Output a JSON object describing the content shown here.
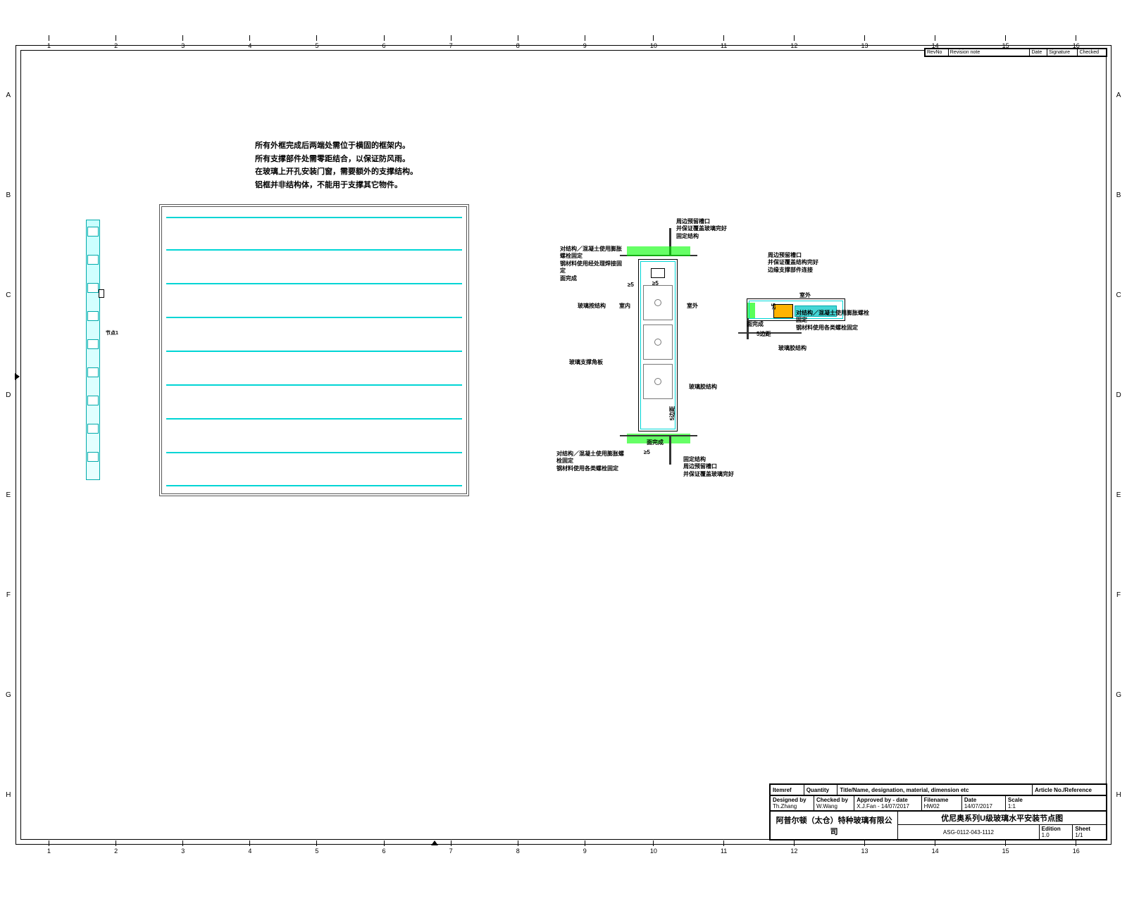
{
  "ruler": {
    "cols": [
      "1",
      "2",
      "3",
      "4",
      "5",
      "6",
      "7",
      "8",
      "9",
      "10",
      "11",
      "12",
      "13",
      "14",
      "15",
      "16"
    ],
    "rows": [
      "A",
      "B",
      "C",
      "D",
      "E",
      "F",
      "G",
      "H"
    ]
  },
  "notes": {
    "l1": "所有外框完成后两端处需位于横固的框架内。",
    "l2": "所有支撑部件处需零距结合，以保证防风雨。",
    "l3": "在玻璃上开孔安装门窗，需要额外的支撑结构。",
    "l4": "铝框并非结构体，不能用于支撑其它物件。"
  },
  "strip_label": "节点1",
  "vdet": {
    "label_top1": "对结构／混凝土使用膨胀螺栓固定",
    "label_top2": "钢材料使用经处理焊接固定",
    "label_top3": "面完成",
    "label_right1": "周边预留槽口",
    "label_right2": "并保证覆盖玻璃完好",
    "label_right3": "固定结构",
    "label_in": "室内",
    "label_out": "室外",
    "seal_l": "玻璃按结构",
    "frame_l": "玻璃支撑角板",
    "seal_r": "玻璃胶结构",
    "bot_l1": "对结构／混凝土使用膨胀螺栓固定",
    "bot_l2": "钢材料使用各类螺栓固定",
    "bot_r1": "固定结构",
    "bot_r2": "周边预留槽口",
    "bot_r3": "并保证覆盖玻璃完好",
    "bot_face": "面完成",
    "d_top": "≥5",
    "d_sq": "≥5",
    "d_bot": "5边距",
    "d_gap": "≥5"
  },
  "hdet": {
    "top1": "周边预留槽口",
    "top2": "并保证覆盖结构完好",
    "top3": "边缘支撑部件连接",
    "out": "室外",
    "face": "面完成",
    "d": "5边距",
    "r1": "对结构／混凝土使用膨胀螺栓固定",
    "r2": "钢材料使用各类螺栓固定",
    "seal": "玻璃胶结构",
    "gap": "≥5"
  },
  "rev": {
    "h1": "RevNo",
    "h2": "Revision note",
    "h3": "Date",
    "h4": "Signature",
    "h5": "Checked"
  },
  "tb": {
    "row1": {
      "c1": "Itemref",
      "c2": "Quantity",
      "c3": "Title/Name, designation, material, dimension etc",
      "c4": "Article No./Reference"
    },
    "row2": {
      "c1": "Designed by",
      "c1v": "Th.Zhang",
      "c2": "Checked by",
      "c2v": "W.Wang",
      "c3": "Approved by - date",
      "c3v": "X.J.Fan - 14/07/2017",
      "c4": "Filename",
      "c4v": "HW02",
      "c5": "Date",
      "c5v": "14/07/2017",
      "c6": "Scale",
      "c6v": "1:1"
    },
    "company": "阿普尔顿（太仓）特种玻璃有限公司",
    "title": "优尼奥系列U级玻璃水平安装节点图",
    "dwg": "ASG-0112-043-1112",
    "ed": "Edition",
    "edv": "1.0",
    "sh": "Sheet",
    "shv": "1/1"
  }
}
